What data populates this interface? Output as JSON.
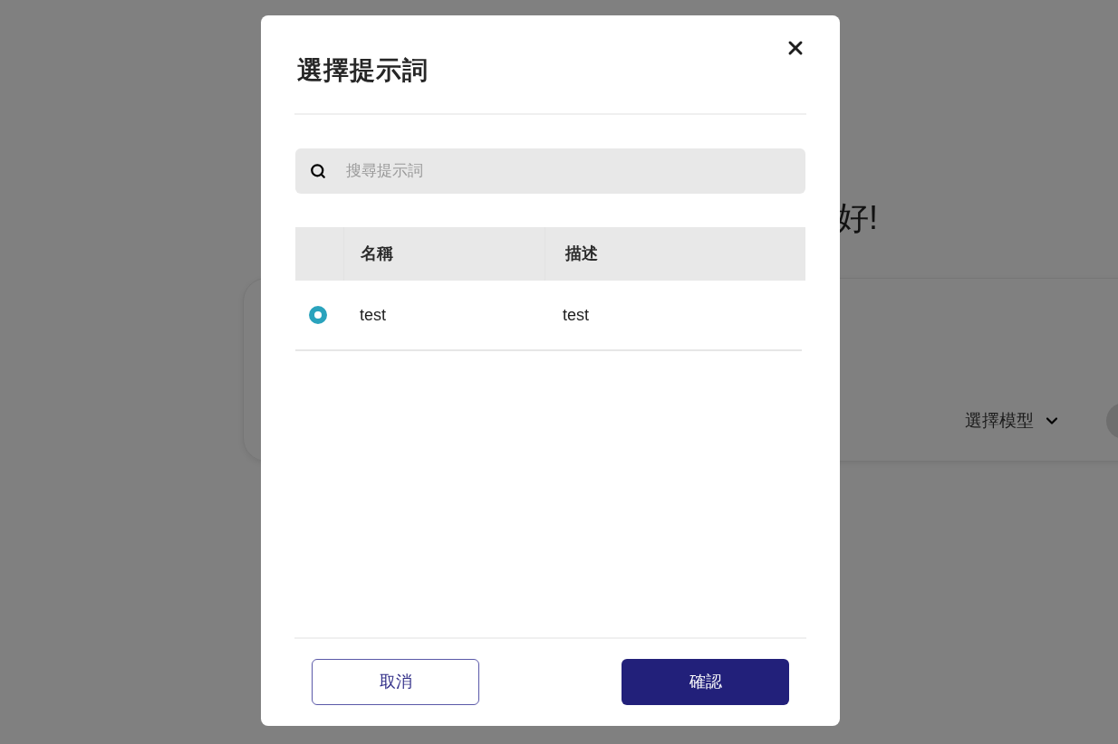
{
  "background": {
    "greeting": "好!",
    "model_selector": {
      "label": "選擇模型"
    }
  },
  "dialog": {
    "title": "選擇提示詞",
    "search": {
      "placeholder": "搜尋提示詞"
    },
    "table": {
      "columns": [
        "名稱",
        "描述"
      ],
      "rows": [
        {
          "name": "test",
          "description": "test",
          "selected": true
        }
      ]
    },
    "buttons": [
      {
        "label": "取消",
        "kind": "secondary"
      },
      {
        "label": "確認",
        "kind": "primary"
      }
    ]
  }
}
